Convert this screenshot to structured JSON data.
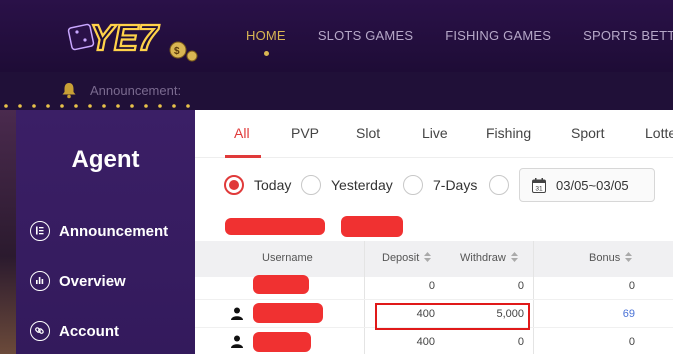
{
  "header": {
    "logo_text": "YE7",
    "nav": [
      {
        "label": "HOME",
        "active": true
      },
      {
        "label": "SLOTS GAMES",
        "active": false
      },
      {
        "label": "FISHING GAMES",
        "active": false
      },
      {
        "label": "SPORTS BETTING",
        "active": false
      }
    ]
  },
  "announcement": {
    "label": "Announcement:",
    "icon": "bell-icon"
  },
  "sidebar": {
    "title": "Agent",
    "items": [
      {
        "label": "Announcement",
        "icon": "list-icon"
      },
      {
        "label": "Overview",
        "icon": "chart-icon"
      },
      {
        "label": "Account",
        "icon": "link-icon"
      }
    ]
  },
  "tabs": [
    {
      "label": "All",
      "active": true
    },
    {
      "label": "PVP",
      "active": false
    },
    {
      "label": "Slot",
      "active": false
    },
    {
      "label": "Live",
      "active": false
    },
    {
      "label": "Fishing",
      "active": false
    },
    {
      "label": "Sport",
      "active": false
    },
    {
      "label": "Lotte",
      "active": false
    }
  ],
  "filters": {
    "options": [
      {
        "label": "Today",
        "checked": true
      },
      {
        "label": "Yesterday",
        "checked": false
      },
      {
        "label": "7-Days",
        "checked": false
      },
      {
        "label": "",
        "checked": false
      }
    ],
    "date_range": "03/05~03/05",
    "calendar_day": "31"
  },
  "table": {
    "columns": [
      "Username",
      "Deposit",
      "Withdraw",
      "Bonus"
    ],
    "rows": [
      {
        "deposit": "0",
        "withdraw": "0",
        "bonus": "0",
        "bonus_link": false
      },
      {
        "deposit": "400",
        "withdraw": "5,000",
        "bonus": "69",
        "bonus_link": true
      },
      {
        "deposit": "400",
        "withdraw": "0",
        "bonus": "0",
        "bonus_link": false
      }
    ]
  },
  "colors": {
    "accent": "#e03a3a",
    "gold": "#d9b653",
    "sidebar": "#3b1f66",
    "link": "#4a72d6"
  }
}
